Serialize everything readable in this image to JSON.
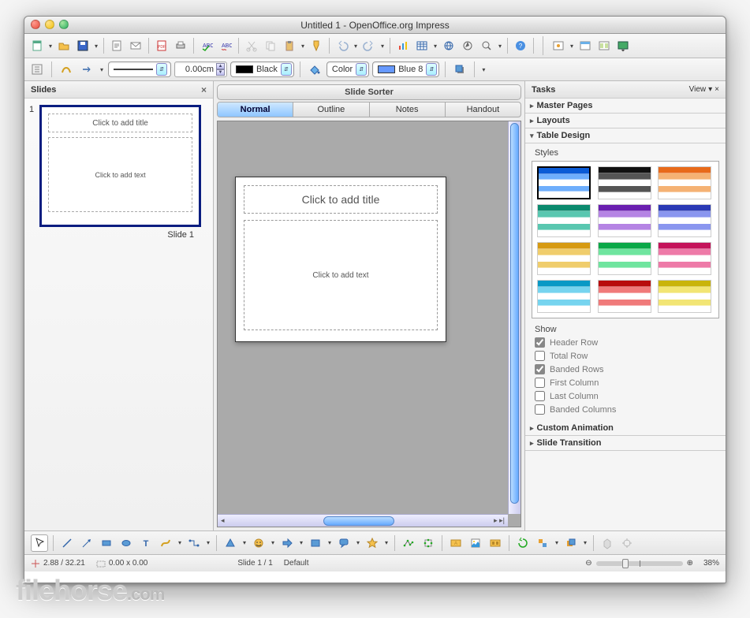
{
  "window": {
    "title": "Untitled 1 - OpenOffice.org Impress"
  },
  "toolbar2": {
    "line_width": "0.00cm",
    "line_color_label": "Black",
    "fill_type_label": "Color",
    "fill_color_label": "Blue 8"
  },
  "slides_panel": {
    "title": "Slides",
    "items": [
      {
        "num": "1",
        "title_placeholder": "Click to add title",
        "content_placeholder": "Click to add text",
        "label": "Slide 1"
      }
    ]
  },
  "main": {
    "sorter_label": "Slide Sorter",
    "tabs": [
      "Normal",
      "Outline",
      "Notes",
      "Handout"
    ],
    "active_tab": 0,
    "canvas": {
      "title_placeholder": "Click to add title",
      "content_placeholder": "Click to add text"
    }
  },
  "tasks_panel": {
    "title": "Tasks",
    "view_label": "View",
    "sections": {
      "master_pages": "Master Pages",
      "layouts": "Layouts",
      "table_design": "Table Design",
      "custom_animation": "Custom Animation",
      "slide_transition": "Slide Transition"
    },
    "table_design": {
      "styles_label": "Styles",
      "show_label": "Show",
      "options": [
        {
          "label": "Header Row",
          "checked": true
        },
        {
          "label": "Total Row",
          "checked": false
        },
        {
          "label": "Banded Rows",
          "checked": true
        },
        {
          "label": "First Column",
          "checked": false
        },
        {
          "label": "Last Column",
          "checked": false
        },
        {
          "label": "Banded Columns",
          "checked": false
        }
      ],
      "styles": [
        {
          "c1": "#0a5bd6",
          "c2": "#6eaefc"
        },
        {
          "c1": "#111",
          "c2": "#555"
        },
        {
          "c1": "#e86a1a",
          "c2": "#f5b274"
        },
        {
          "c1": "#0b8a6e",
          "c2": "#59c7b0"
        },
        {
          "c1": "#6a1fb0",
          "c2": "#b584e4"
        },
        {
          "c1": "#2a39b5",
          "c2": "#8a96ef"
        },
        {
          "c1": "#d69a12",
          "c2": "#f0cd6c"
        },
        {
          "c1": "#0aa848",
          "c2": "#6fe59f"
        },
        {
          "c1": "#c4135a",
          "c2": "#ee7aa8"
        },
        {
          "c1": "#0899c5",
          "c2": "#76d4ef"
        },
        {
          "c1": "#b80c0c",
          "c2": "#f07a7a"
        },
        {
          "c1": "#c9b40b",
          "c2": "#f2e574"
        }
      ]
    }
  },
  "status": {
    "position": "2.88 / 32.21",
    "size": "0.00 x 0.00",
    "slide": "Slide 1 / 1",
    "style": "Default",
    "zoom": "38%"
  },
  "watermark": {
    "brand": "filehorse",
    "domain": ".com"
  }
}
